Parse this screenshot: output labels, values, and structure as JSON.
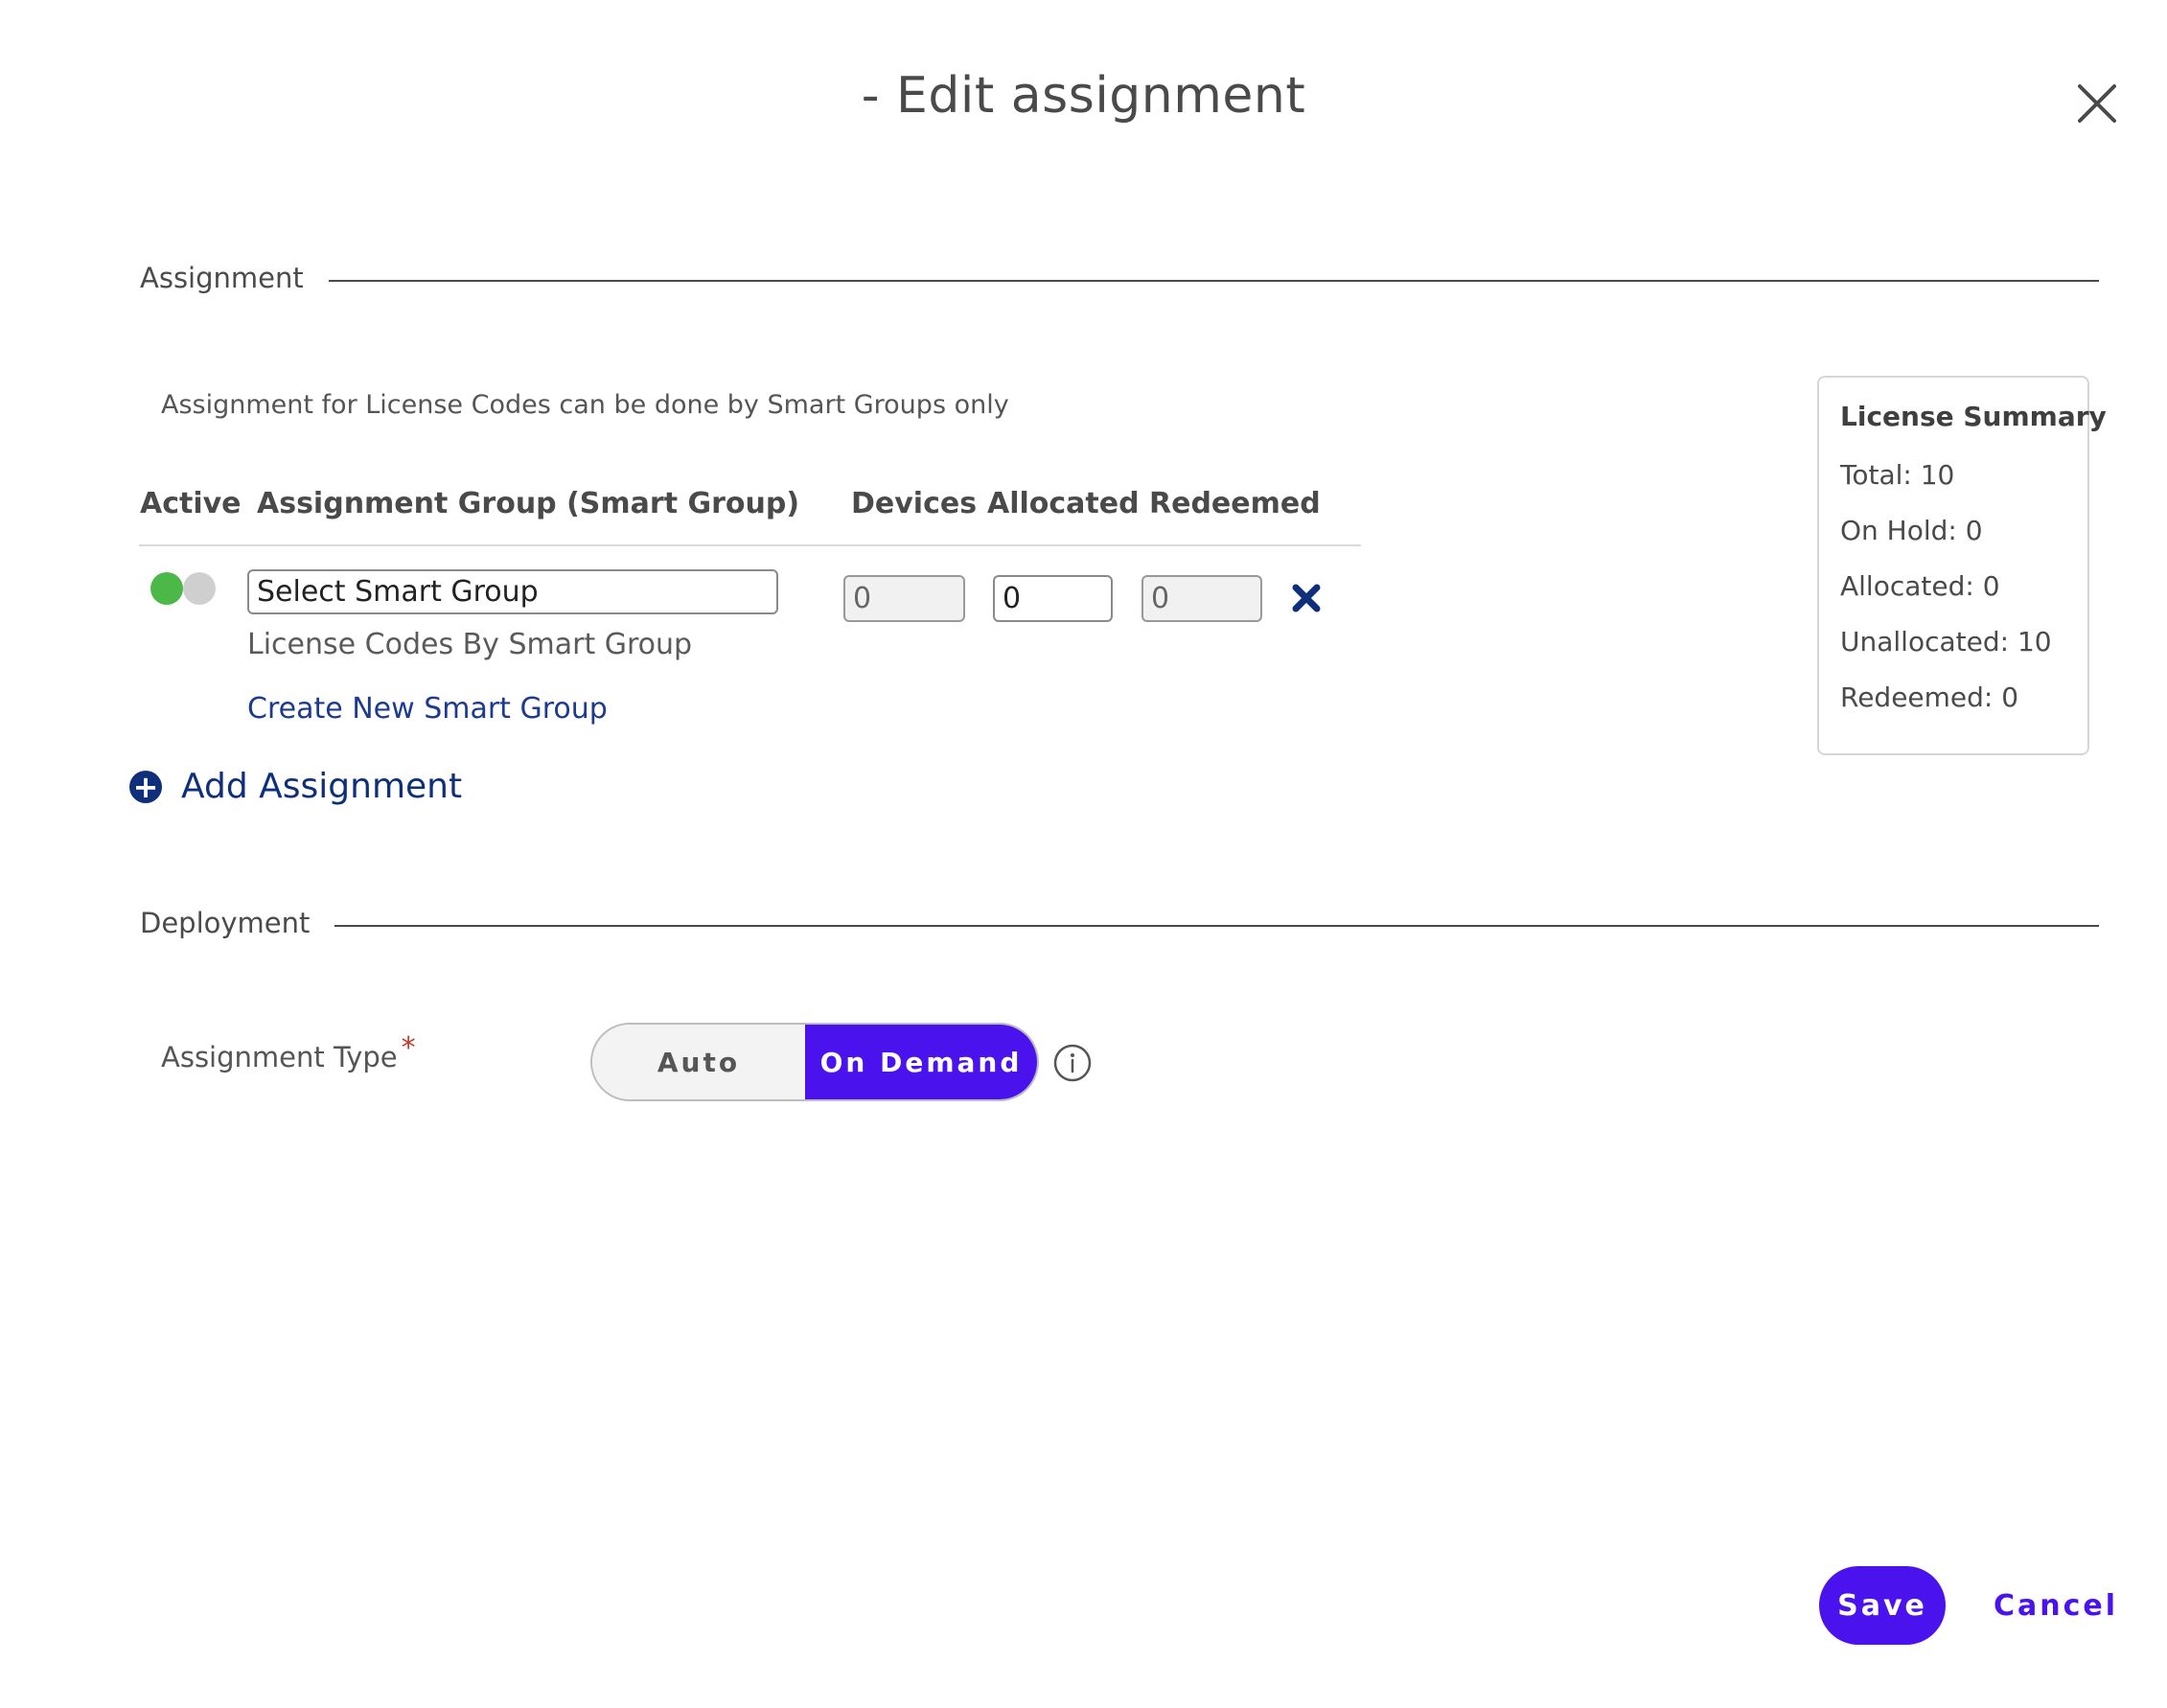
{
  "dialog": {
    "title": "- Edit assignment"
  },
  "sections": {
    "assignment": "Assignment",
    "deployment": "Deployment"
  },
  "assignment": {
    "note": "Assignment for License Codes can be done by Smart Groups only",
    "columns": {
      "active": "Active",
      "group": "Assignment Group (Smart Group)",
      "devices": "Devices",
      "allocated": "Allocated",
      "redeemed": "Redeemed"
    },
    "row": {
      "smart_group_value": "Select Smart Group",
      "devices_value": "0",
      "allocated_value": "0",
      "redeemed_value": "0",
      "sub_label": "License Codes By Smart Group",
      "create_link": "Create New Smart Group"
    },
    "add_assignment": "Add Assignment",
    "toggle_colors": {
      "on": "#4cb848",
      "off": "#cfcfcf"
    },
    "remove_icon": "close-x-icon"
  },
  "license_summary": {
    "title": "License Summary",
    "total": "Total: 10",
    "on_hold": "On Hold: 0",
    "allocated": "Allocated: 0",
    "unallocated": "Unallocated: 10",
    "redeemed": "Redeemed: 0"
  },
  "deployment": {
    "assignment_type_label": "Assignment Type",
    "required_marker": "*",
    "options": {
      "auto": "Auto",
      "on_demand": "On Demand"
    },
    "selected": "On Demand"
  },
  "footer": {
    "save": "Save",
    "cancel": "Cancel"
  },
  "colors": {
    "primary": "#4a12ec",
    "link": "#1c3a8f",
    "navy_icon": "#0f2f7a"
  }
}
